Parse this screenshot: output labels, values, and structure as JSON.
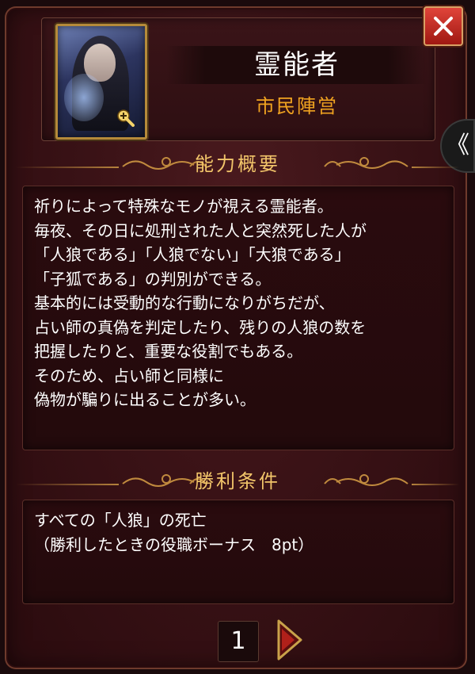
{
  "role": {
    "name": "霊能者",
    "faction": "市民陣営"
  },
  "side_tab_glyph": "《",
  "ability": {
    "heading": "能力概要",
    "text": "祈りによって特殊なモノが視える霊能者。\n毎夜、その日に処刑された人と突然死した人が\n「人狼である」「人狼でない」「大狼である」\n「子狐である」の判別ができる。\n基本的には受動的な行動になりがちだが、\n占い師の真偽を判定したり、残りの人狼の数を\n把握したりと、重要な役割でもある。\nそのため、占い師と同様に\n偽物が騙りに出ることが多い。"
  },
  "victory": {
    "heading": "勝利条件",
    "text": "すべての「人狼」の死亡\n（勝利したときの役職ボーナス　8pt）"
  },
  "pager": {
    "page": "1"
  },
  "colors": {
    "accent_gold": "#f2c56a",
    "faction_orange": "#f0a320",
    "close_red": "#c8281e"
  },
  "icons": {
    "close": "close-x-icon",
    "zoom": "zoom-in-icon",
    "next": "next-arrow-icon",
    "side": "chevron-left-icon"
  }
}
